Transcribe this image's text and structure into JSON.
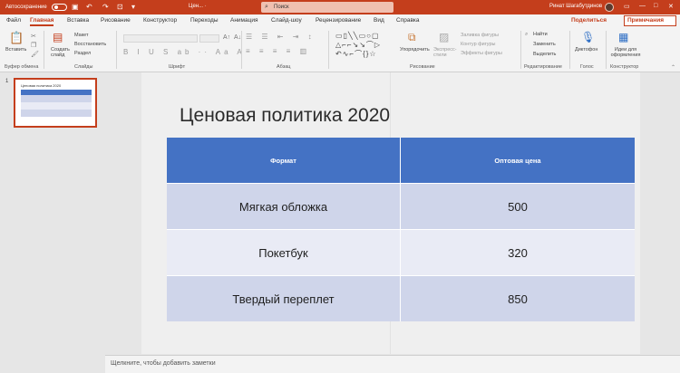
{
  "titlebar": {
    "autosave_label": "Автосохранение",
    "autosave_state": "off",
    "doc_name": "Цен... ·",
    "search_placeholder": "Поиск",
    "user_name": "Ринат Шагабутдинов"
  },
  "tabs": [
    "Файл",
    "Главная",
    "Вставка",
    "Рисование",
    "Конструктор",
    "Переходы",
    "Анимация",
    "Слайд-шоу",
    "Рецензирование",
    "Вид",
    "Справка"
  ],
  "active_tab": "Главная",
  "share_label": "Поделиться",
  "comments_label": "Примечания",
  "ribbon": {
    "clipboard": {
      "paste": "Вставить",
      "label": "Буфер обмена"
    },
    "slides": {
      "new_slide": "Создать слайд",
      "layout": "Макет",
      "reset": "Восстановить",
      "section": "Раздел",
      "label": "Слайды"
    },
    "font": {
      "label": "Шрифт"
    },
    "paragraph": {
      "label": "Абзац"
    },
    "drawing": {
      "arrange": "Упорядочить",
      "quick_styles": "Экспресс-стили",
      "fill": "Заливка фигуры",
      "outline": "Контур фигуры",
      "effects": "Эффекты фигуры",
      "label": "Рисование"
    },
    "editing": {
      "find": "Найти",
      "replace": "Заменить",
      "select": "Выделить",
      "label": "Редактирование"
    },
    "voice": {
      "dictate": "Диктофон",
      "label": "Голос"
    },
    "designer": {
      "ideas": "Идеи для оформления",
      "label": "Конструктор"
    }
  },
  "thumbnail": {
    "number": "1",
    "title": "Ценовая политика 2020"
  },
  "slide": {
    "title": "Ценовая политика 2020",
    "table": {
      "headers": [
        "Формат",
        "Оптовая цена"
      ],
      "rows": [
        [
          "Мягкая обложка",
          "500"
        ],
        [
          "Покетбук",
          "320"
        ],
        [
          "Твердый переплет",
          "850"
        ]
      ]
    }
  },
  "notes_placeholder": "Щелкните, чтобы добавить заметки",
  "colors": {
    "accent": "#c43e1c",
    "table_header": "#4472c4",
    "row_odd": "#cfd5ea",
    "row_even": "#e9ebf5"
  },
  "icons": [
    "save-icon",
    "undo-icon",
    "redo-icon",
    "search-icon",
    "paste-icon",
    "new-slide-icon",
    "arrange-icon",
    "microphone-icon",
    "design-ideas-icon"
  ]
}
